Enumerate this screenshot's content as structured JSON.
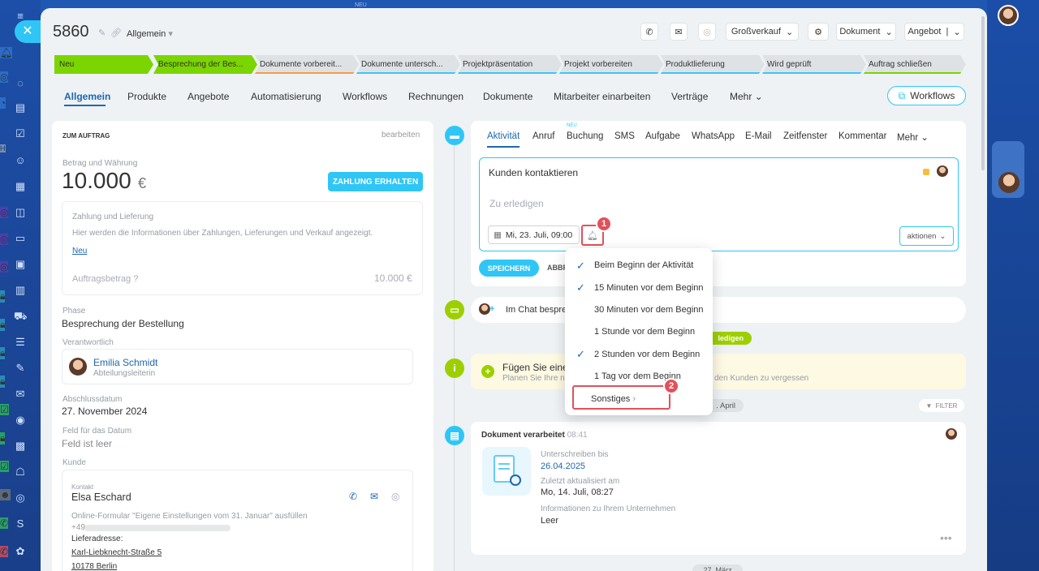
{
  "header": {
    "id": "5860",
    "category": "Allgemein",
    "btn_grossverkauf": "Großverkauf",
    "btn_dokument": "Dokument",
    "btn_angebot": "Angebot",
    "neu_top": "NEU"
  },
  "stages": [
    "Neu",
    "Besprechung der Bes...",
    "Dokumente vorbereit...",
    "Dokumente untersch...",
    "Projektpräsentation",
    "Projekt vorbereiten",
    "Produktlieferung",
    "Wird geprüft",
    "Auftrag schließen"
  ],
  "tabs": [
    "Allgemein",
    "Produkte",
    "Angebote",
    "Automatisierung",
    "Workflows",
    "Rechnungen",
    "Dokumente",
    "Mitarbeiter einarbeiten",
    "Verträge",
    "Mehr"
  ],
  "workflows_btn": "Workflows",
  "left": {
    "section": "ZUM AUFTRAG",
    "edit": "bearbeiten",
    "amount_label": "Betrag und Währung",
    "amount": "10.000",
    "currency": "€",
    "pay_btn": "ZAHLUNG ERHALTEN",
    "pay_title": "Zahlung und Lieferung",
    "pay_desc": "Hier werden die Informationen über Zahlungen, Lieferungen und Verkauf angezeigt.",
    "pay_link": "Neu",
    "order_label": "Auftragsbetrag",
    "order_value": "10.000 €",
    "phase_label": "Phase",
    "phase": "Besprechung der Bestellung",
    "resp_label": "Verantwortlich",
    "resp_name": "Emilia Schmidt",
    "resp_role": "Abteilungsleiterin",
    "close_label": "Abschlussdatum",
    "close_date": "27. November 2024",
    "datefield_label": "Feld für das Datum",
    "datefield_value": "Feld ist leer",
    "customer_label": "Kunde",
    "contact_label": "Kontakt",
    "contact_name": "Elsa Eschard",
    "contact_src": "Online-Formular \"Eigene Einstellungen vom 31. Januar\" ausfüllen",
    "phone": "+49",
    "addr_label": "Lieferadresse:",
    "street": "Karl-Liebknecht-Straße 5",
    "city": "10178 Berlin"
  },
  "activity_tabs": [
    "Aktivität",
    "Anruf",
    "Buchung",
    "SMS",
    "Aufgabe",
    "WhatsApp",
    "E-Mail",
    "Zeitfenster",
    "Kommentar",
    "Mehr"
  ],
  "neu_badge": "NEU",
  "editor": {
    "title": "Kunden kontaktieren",
    "placeholder": "Zu erledigen",
    "date": "Mi, 23. Juli, 09:00",
    "actions": "aktionen",
    "save": "SPEICHERN",
    "cancel": "ABBR"
  },
  "reminder_menu": [
    {
      "label": "Beim Beginn der Aktivität",
      "checked": true
    },
    {
      "label": "15 Minuten vor dem Beginn",
      "checked": true
    },
    {
      "label": "30 Minuten vor dem Beginn",
      "checked": false
    },
    {
      "label": "1 Stunde vor dem Beginn",
      "checked": false
    },
    {
      "label": "2 Stunden vor dem Beginn",
      "checked": true
    },
    {
      "label": "1 Tag vor dem Beginn",
      "checked": false
    },
    {
      "label": "Sonstiges",
      "checked": false
    }
  ],
  "callouts": [
    "1",
    "2"
  ],
  "timeline": {
    "chat": "Im Chat bespre",
    "todo_badge": "ledigen",
    "hint_title": "Fügen Sie eine",
    "hint_sub": "Planen Sie Ihre n",
    "hint_tail": "den Kunden zu vergessen",
    "date_april": ". April",
    "filter": "FILTER",
    "doc_title": "Dokument verarbeitet",
    "doc_time": "08:41",
    "sign_label": "Unterschreiben bis",
    "sign_date": "26.04.2025",
    "upd_label": "Zuletzt aktualisiert am",
    "upd_date": "Mo, 14. Juli, 08:27",
    "info_label": "Informationen zu Ihrem Unternehmen",
    "info_value": "Leer",
    "date_maerz": "27. März"
  }
}
